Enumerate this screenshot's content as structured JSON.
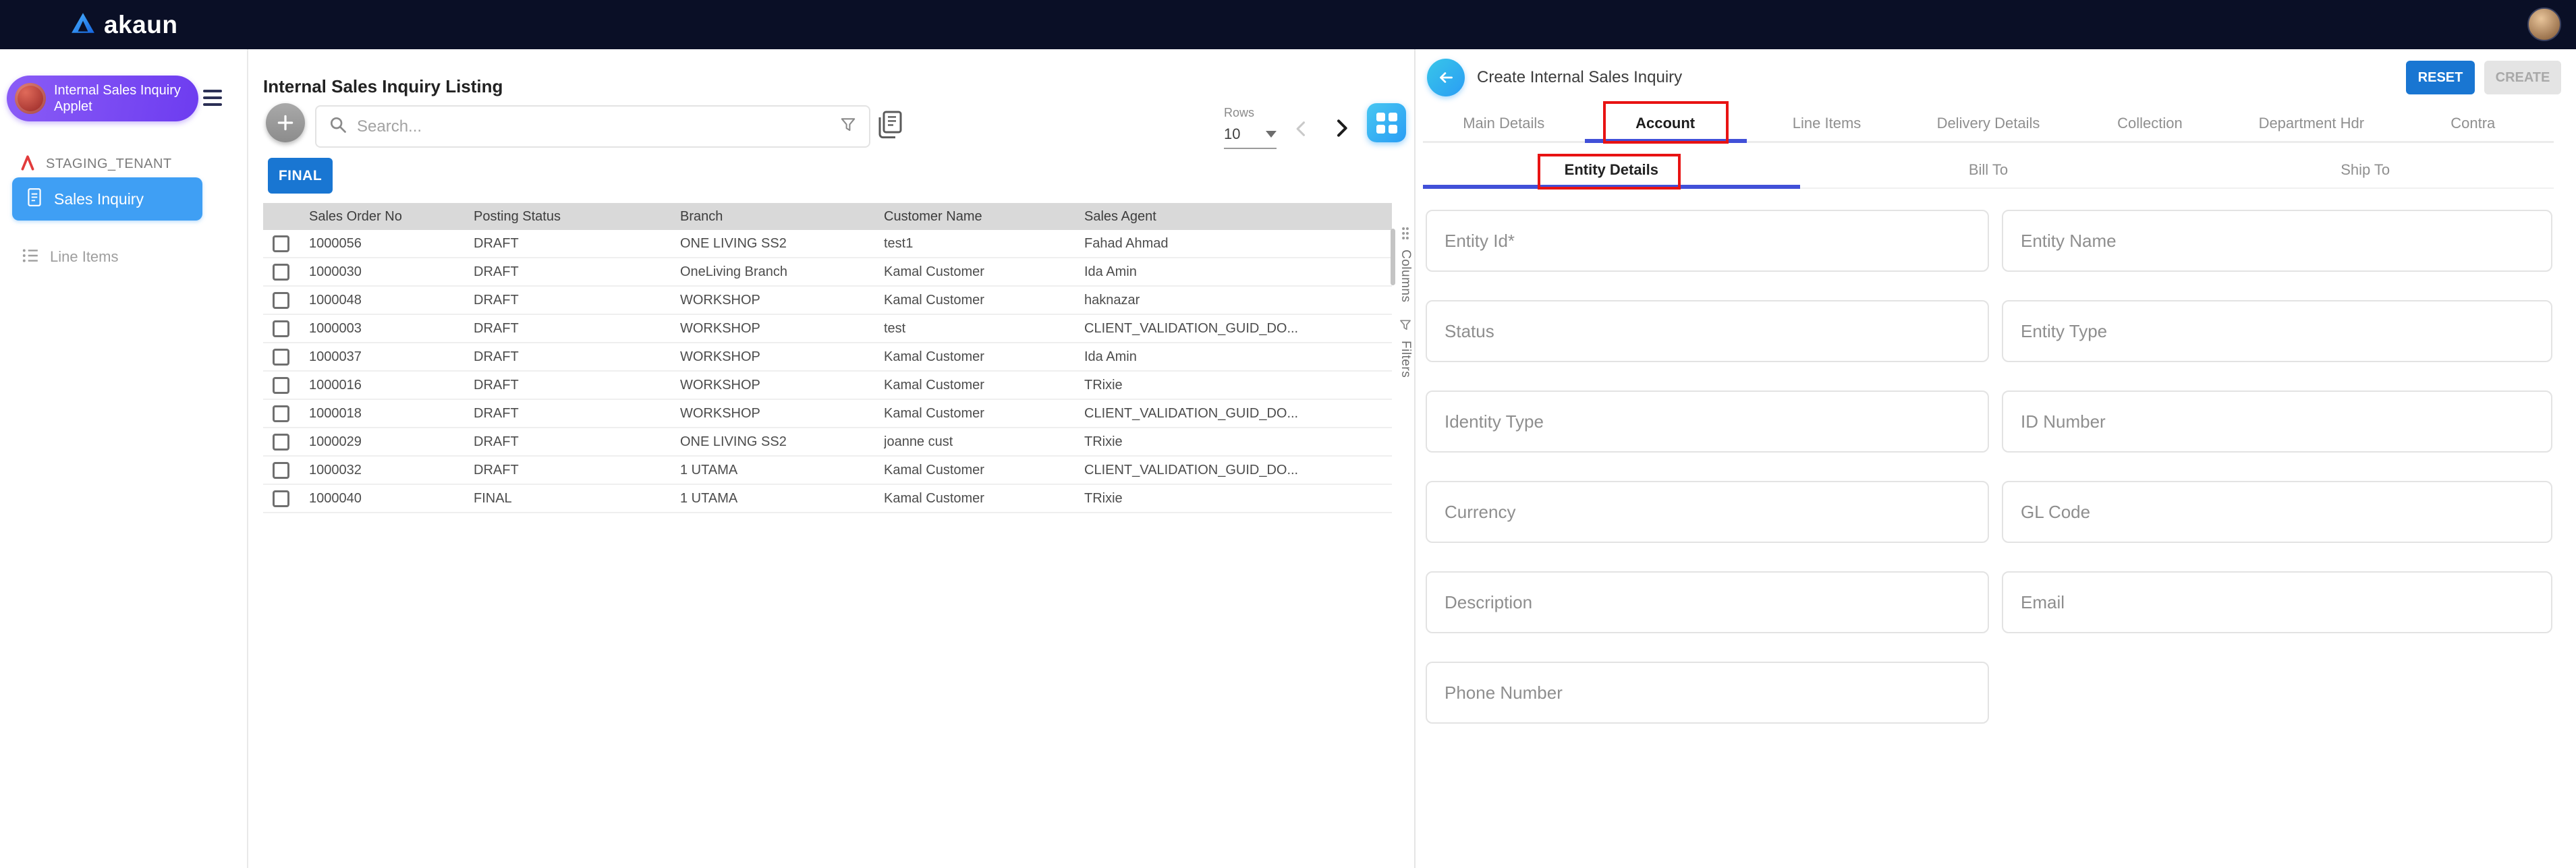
{
  "topbar": {
    "logo_text": "akaun"
  },
  "sidebar": {
    "applet_name": "Internal Sales Inquiry Applet",
    "tenant_label": "STAGING_TENANT",
    "sales_inquiry_label": "Sales Inquiry",
    "line_items_label": "Line Items"
  },
  "listing": {
    "title": "Internal Sales Inquiry Listing",
    "search_placeholder": "Search...",
    "rows_label": "Rows",
    "rows_per_page": "10",
    "final_button_label": "FINAL",
    "columns_tab_label": "Columns",
    "filters_tab_label": "Filters",
    "table": {
      "columns": [
        "Sales Order No",
        "Posting Status",
        "Branch",
        "Customer Name",
        "Sales Agent"
      ],
      "rows": [
        [
          "1000056",
          "DRAFT",
          "ONE LIVING SS2",
          "test1",
          "Fahad Ahmad"
        ],
        [
          "1000030",
          "DRAFT",
          "OneLiving Branch",
          "Kamal Customer",
          "Ida Amin"
        ],
        [
          "1000048",
          "DRAFT",
          "WORKSHOP",
          "Kamal Customer",
          "haknazar"
        ],
        [
          "1000003",
          "DRAFT",
          "WORKSHOP",
          "test",
          "CLIENT_VALIDATION_GUID_DO..."
        ],
        [
          "1000037",
          "DRAFT",
          "WORKSHOP",
          "Kamal Customer",
          "Ida Amin"
        ],
        [
          "1000016",
          "DRAFT",
          "WORKSHOP",
          "Kamal Customer",
          "TRixie"
        ],
        [
          "1000018",
          "DRAFT",
          "WORKSHOP",
          "Kamal Customer",
          "CLIENT_VALIDATION_GUID_DO..."
        ],
        [
          "1000029",
          "DRAFT",
          "ONE LIVING SS2",
          "joanne cust",
          "TRixie"
        ],
        [
          "1000032",
          "DRAFT",
          "1 UTAMA",
          "Kamal Customer",
          "CLIENT_VALIDATION_GUID_DO..."
        ],
        [
          "1000040",
          "FINAL",
          "1 UTAMA",
          "Kamal Customer",
          "TRixie"
        ]
      ]
    }
  },
  "detail": {
    "title": "Create Internal Sales Inquiry",
    "reset_button_label": "RESET",
    "create_button_label": "CREATE",
    "tabs": [
      "Main Details",
      "Account",
      "Line Items",
      "Delivery Details",
      "Collection",
      "Department Hdr",
      "Contra"
    ],
    "active_tab": "Account",
    "subtabs": [
      "Entity Details",
      "Bill To",
      "Ship To"
    ],
    "active_subtab": "Entity Details",
    "fields": [
      "Entity Id*",
      "Entity Name",
      "Status",
      "Entity Type",
      "Identity Type",
      "ID Number",
      "Currency",
      "GL Code",
      "Description",
      "Email",
      "Phone Number"
    ]
  },
  "colors": {
    "topbar_bg": "#0a0f26",
    "primary_blue": "#1976d2",
    "nav_active_blue": "#3f9ff4",
    "applet_purple": "#7a52f4",
    "tab_indicator": "#4150d8",
    "annotation_red": "#e81313"
  }
}
